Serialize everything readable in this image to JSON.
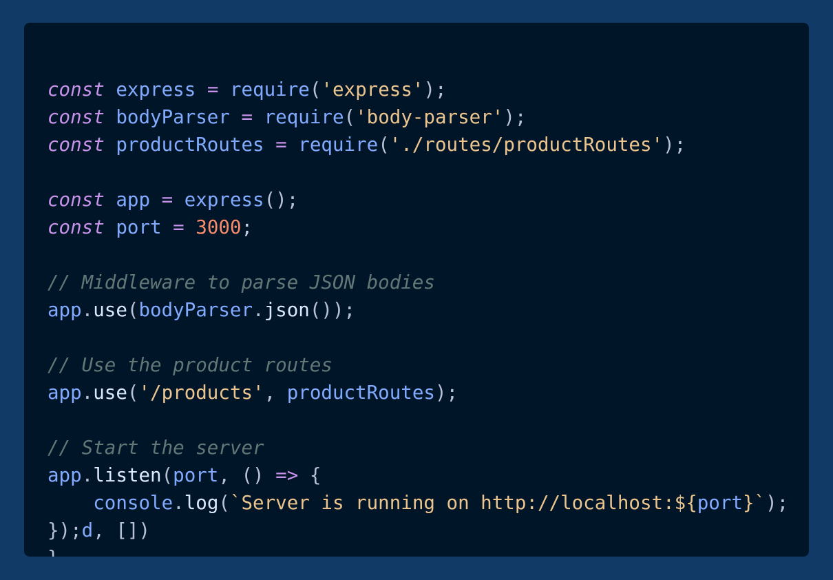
{
  "code": {
    "lines": [
      [
        {
          "t": "const",
          "c": "keyword"
        },
        {
          "t": " ",
          "c": "plain"
        },
        {
          "t": "express",
          "c": "var"
        },
        {
          "t": " ",
          "c": "plain"
        },
        {
          "t": "=",
          "c": "op"
        },
        {
          "t": " ",
          "c": "plain"
        },
        {
          "t": "require",
          "c": "var"
        },
        {
          "t": "(",
          "c": "punct"
        },
        {
          "t": "'express'",
          "c": "string"
        },
        {
          "t": ");",
          "c": "punct"
        }
      ],
      [
        {
          "t": "const",
          "c": "keyword"
        },
        {
          "t": " ",
          "c": "plain"
        },
        {
          "t": "bodyParser",
          "c": "var"
        },
        {
          "t": " ",
          "c": "plain"
        },
        {
          "t": "=",
          "c": "op"
        },
        {
          "t": " ",
          "c": "plain"
        },
        {
          "t": "require",
          "c": "var"
        },
        {
          "t": "(",
          "c": "punct"
        },
        {
          "t": "'body-parser'",
          "c": "string"
        },
        {
          "t": ");",
          "c": "punct"
        }
      ],
      [
        {
          "t": "const",
          "c": "keyword"
        },
        {
          "t": " ",
          "c": "plain"
        },
        {
          "t": "productRoutes",
          "c": "var"
        },
        {
          "t": " ",
          "c": "plain"
        },
        {
          "t": "=",
          "c": "op"
        },
        {
          "t": " ",
          "c": "plain"
        },
        {
          "t": "require",
          "c": "var"
        },
        {
          "t": "(",
          "c": "punct"
        },
        {
          "t": "'./routes/productRoutes'",
          "c": "string"
        },
        {
          "t": ");",
          "c": "punct"
        }
      ],
      [],
      [
        {
          "t": "const",
          "c": "keyword"
        },
        {
          "t": " ",
          "c": "plain"
        },
        {
          "t": "app",
          "c": "var"
        },
        {
          "t": " ",
          "c": "plain"
        },
        {
          "t": "=",
          "c": "op"
        },
        {
          "t": " ",
          "c": "plain"
        },
        {
          "t": "express",
          "c": "var"
        },
        {
          "t": "();",
          "c": "punct"
        }
      ],
      [
        {
          "t": "const",
          "c": "keyword"
        },
        {
          "t": " ",
          "c": "plain"
        },
        {
          "t": "port",
          "c": "var"
        },
        {
          "t": " ",
          "c": "plain"
        },
        {
          "t": "=",
          "c": "op"
        },
        {
          "t": " ",
          "c": "plain"
        },
        {
          "t": "3000",
          "c": "number"
        },
        {
          "t": ";",
          "c": "plain"
        }
      ],
      [],
      [
        {
          "t": "// Middleware to parse JSON bodies",
          "c": "comment"
        }
      ],
      [
        {
          "t": "app",
          "c": "var"
        },
        {
          "t": ".",
          "c": "punct"
        },
        {
          "t": "use",
          "c": "method"
        },
        {
          "t": "(",
          "c": "punct"
        },
        {
          "t": "bodyParser",
          "c": "var"
        },
        {
          "t": ".",
          "c": "punct"
        },
        {
          "t": "json",
          "c": "method"
        },
        {
          "t": "());",
          "c": "punct"
        }
      ],
      [],
      [
        {
          "t": "// Use the product routes",
          "c": "comment"
        }
      ],
      [
        {
          "t": "app",
          "c": "var"
        },
        {
          "t": ".",
          "c": "punct"
        },
        {
          "t": "use",
          "c": "method"
        },
        {
          "t": "(",
          "c": "punct"
        },
        {
          "t": "'/products'",
          "c": "string"
        },
        {
          "t": ", ",
          "c": "punct"
        },
        {
          "t": "productRoutes",
          "c": "var"
        },
        {
          "t": ");",
          "c": "punct"
        }
      ],
      [],
      [
        {
          "t": "// Start the server",
          "c": "comment"
        }
      ],
      [
        {
          "t": "app",
          "c": "var"
        },
        {
          "t": ".",
          "c": "punct"
        },
        {
          "t": "listen",
          "c": "method"
        },
        {
          "t": "(",
          "c": "punct"
        },
        {
          "t": "port",
          "c": "var"
        },
        {
          "t": ", () ",
          "c": "punct"
        },
        {
          "t": "=>",
          "c": "op"
        },
        {
          "t": " {",
          "c": "punct"
        }
      ],
      [
        {
          "t": "    ",
          "c": "plain"
        },
        {
          "t": "console",
          "c": "var"
        },
        {
          "t": ".",
          "c": "punct"
        },
        {
          "t": "log",
          "c": "method"
        },
        {
          "t": "(",
          "c": "punct"
        },
        {
          "t": "`Server is running on http://localhost:${",
          "c": "string"
        },
        {
          "t": "port",
          "c": "var"
        },
        {
          "t": "}`",
          "c": "string"
        },
        {
          "t": ");",
          "c": "punct"
        }
      ],
      [
        {
          "t": "});",
          "c": "punct"
        },
        {
          "t": "d",
          "c": "var"
        },
        {
          "t": ", [])",
          "c": "punct"
        }
      ],
      [
        {
          "t": "}",
          "c": "punct"
        }
      ]
    ]
  },
  "colors": {
    "page_background": "#123a66",
    "editor_background": "#001628"
  }
}
